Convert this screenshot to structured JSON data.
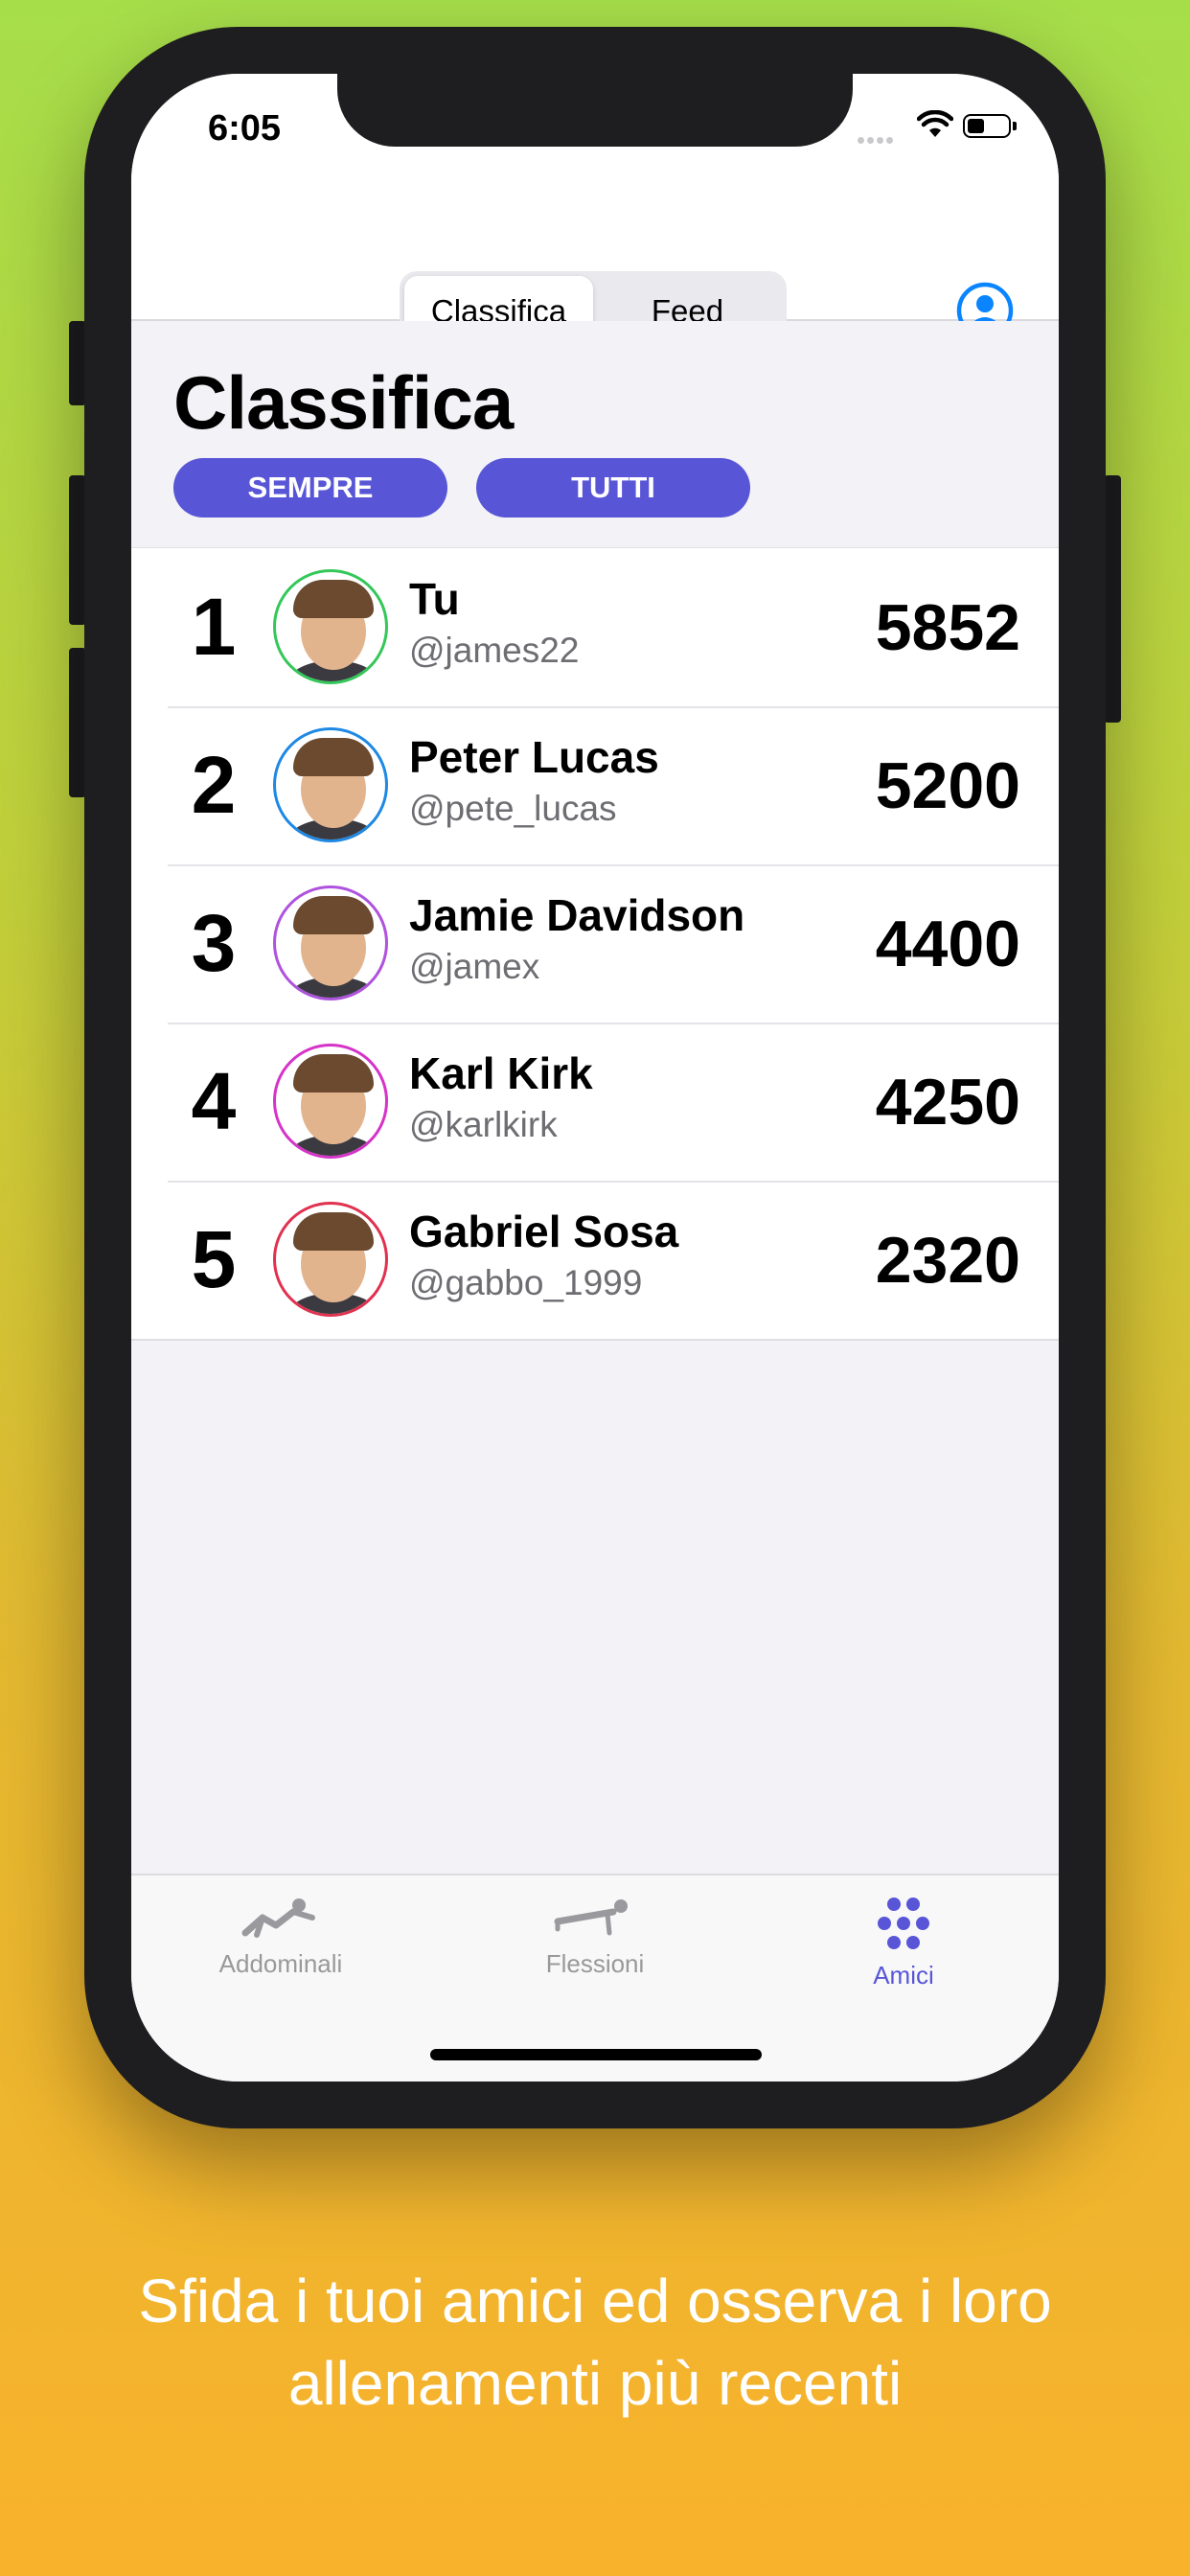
{
  "status": {
    "time": "6:05",
    "battery_level": 0.45
  },
  "navbar": {
    "segments": [
      "Classifica",
      "Feed"
    ],
    "active_segment": 0
  },
  "header": {
    "title": "Classifica",
    "filter_period": "SEMPRE",
    "filter_scope": "TUTTI"
  },
  "leaderboard": [
    {
      "rank": "1",
      "name": "Tu",
      "handle": "@james22",
      "score": "5852",
      "ring_color": "#34c759"
    },
    {
      "rank": "2",
      "name": "Peter Lucas",
      "handle": "@pete_lucas",
      "score": "5200",
      "ring_color": "#1e88e5"
    },
    {
      "rank": "3",
      "name": "Jamie Davidson",
      "handle": "@jamex",
      "score": "4400",
      "ring_color": "#af52de"
    },
    {
      "rank": "4",
      "name": "Karl Kirk",
      "handle": "@karlkirk",
      "score": "4250",
      "ring_color": "#d633c8"
    },
    {
      "rank": "5",
      "name": "Gabriel Sosa",
      "handle": "@gabbo_1999",
      "score": "2320",
      "ring_color": "#e0314f"
    }
  ],
  "tabbar": {
    "tabs": [
      {
        "label": "Addominali",
        "icon": "situp-icon"
      },
      {
        "label": "Flessioni",
        "icon": "pushup-icon"
      },
      {
        "label": "Amici",
        "icon": "friends-icon"
      }
    ],
    "active_tab": 2
  },
  "caption": {
    "line1": "Sfida i tuoi amici ed osserva i loro",
    "line2": "allenamenti più recenti"
  },
  "colors": {
    "accent": "#5856d6",
    "profile_blue": "#0a84ff"
  }
}
